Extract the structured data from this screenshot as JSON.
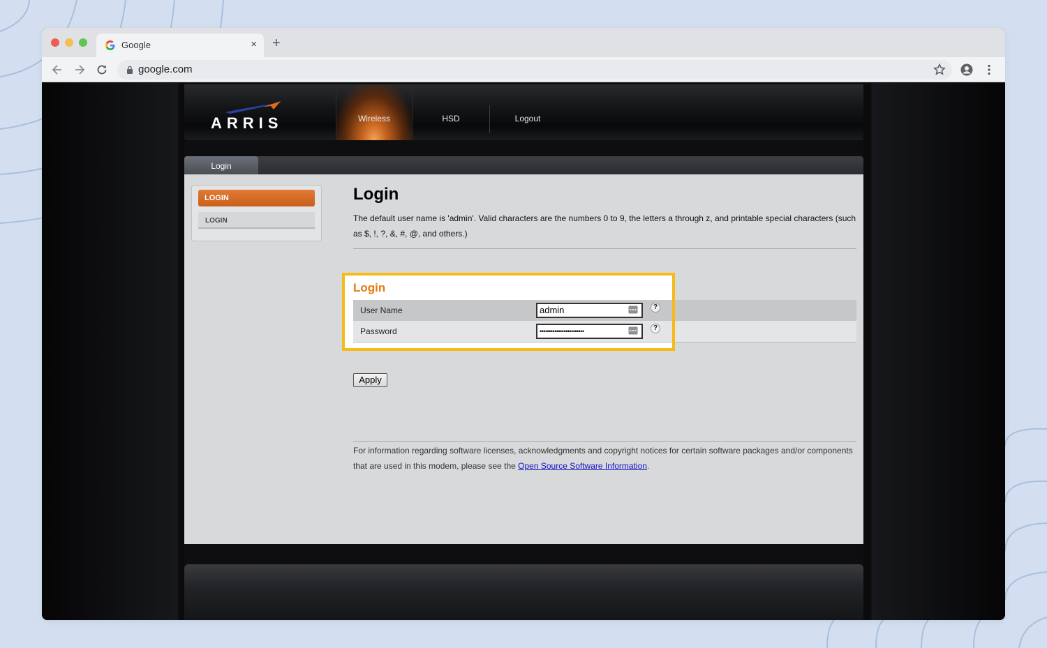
{
  "browser": {
    "tab_title": "Google",
    "url": "google.com",
    "tab_close": "×",
    "new_tab": "+"
  },
  "router": {
    "brand": "ARRIS",
    "nav": [
      {
        "label": "Wireless",
        "active": true
      },
      {
        "label": "HSD",
        "active": false
      },
      {
        "label": "Logout",
        "active": false
      }
    ],
    "subtab": "Login",
    "sidebar": {
      "heading": "LOGIN",
      "item": "LOGIN"
    },
    "page_title": "Login",
    "description": "The default user name is 'admin'. Valid characters are the numbers 0 to 9, the letters a through z, and printable special characters (such as $, !, ?, &, #, @, and others.)",
    "section_title": "Login",
    "fields": {
      "username_label": "User Name",
      "username_value": "admin",
      "password_label": "Password",
      "password_value": "••••••••••••••••••••••••",
      "help": "?"
    },
    "apply_label": "Apply",
    "footer_text": "For information regarding software licenses, acknowledgments and copyright notices for certain software packages and/or components that are used in this modem, please see the",
    "footer_link": "Open Source Software Information",
    "footer_end": "."
  },
  "colors": {
    "accent_orange": "#e8790f",
    "highlight_yellow": "#f6bb18",
    "link_blue": "#1010c8"
  }
}
